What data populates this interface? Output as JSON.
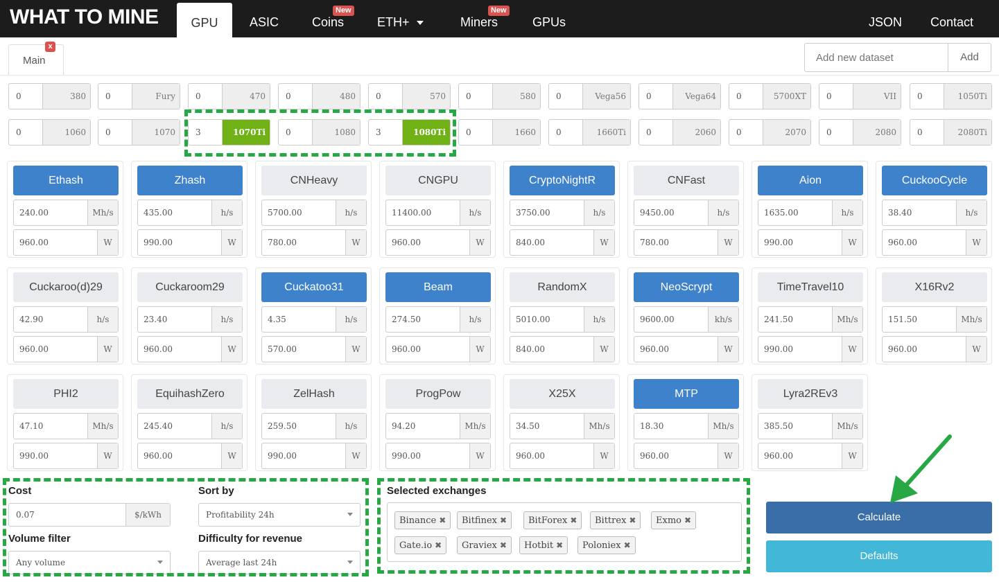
{
  "brand": "WHAT TO MINE",
  "nav": {
    "gpu": "GPU",
    "asic": "ASIC",
    "coins": "Coins",
    "coins_badge": "New",
    "eth": "ETH+",
    "miners": "Miners",
    "miners_badge": "New",
    "gpus": "GPUs",
    "json": "JSON",
    "contact": "Contact"
  },
  "datasets": {
    "tab": "Main",
    "close": "x",
    "input_placeholder": "Add new dataset",
    "add": "Add"
  },
  "gpus": [
    {
      "qty": "0",
      "name": "380"
    },
    {
      "qty": "0",
      "name": "Fury"
    },
    {
      "qty": "0",
      "name": "470"
    },
    {
      "qty": "0",
      "name": "480"
    },
    {
      "qty": "0",
      "name": "570"
    },
    {
      "qty": "0",
      "name": "580"
    },
    {
      "qty": "0",
      "name": "Vega56"
    },
    {
      "qty": "0",
      "name": "Vega64"
    },
    {
      "qty": "0",
      "name": "5700XT"
    },
    {
      "qty": "0",
      "name": "VII"
    },
    {
      "qty": "0",
      "name": "1050Ti"
    },
    {
      "qty": "0",
      "name": "1060"
    },
    {
      "qty": "0",
      "name": "1070"
    },
    {
      "qty": "3",
      "name": "1070Ti",
      "on": true
    },
    {
      "qty": "0",
      "name": "1080"
    },
    {
      "qty": "3",
      "name": "1080Ti",
      "on": true
    },
    {
      "qty": "0",
      "name": "1660"
    },
    {
      "qty": "0",
      "name": "1660Ti"
    },
    {
      "qty": "0",
      "name": "2060"
    },
    {
      "qty": "0",
      "name": "2070"
    },
    {
      "qty": "0",
      "name": "2080"
    },
    {
      "qty": "0",
      "name": "2080Ti"
    }
  ],
  "algos": [
    {
      "name": "Ethash",
      "on": true,
      "hashrate": "240.00",
      "unit": "Mh/s",
      "power": "960.00"
    },
    {
      "name": "Zhash",
      "on": true,
      "hashrate": "435.00",
      "unit": "h/s",
      "power": "990.00"
    },
    {
      "name": "CNHeavy",
      "on": false,
      "hashrate": "5700.00",
      "unit": "h/s",
      "power": "780.00"
    },
    {
      "name": "CNGPU",
      "on": false,
      "hashrate": "11400.00",
      "unit": "h/s",
      "power": "960.00"
    },
    {
      "name": "CryptoNightR",
      "on": true,
      "hashrate": "3750.00",
      "unit": "h/s",
      "power": "840.00"
    },
    {
      "name": "CNFast",
      "on": false,
      "hashrate": "9450.00",
      "unit": "h/s",
      "power": "780.00"
    },
    {
      "name": "Aion",
      "on": true,
      "hashrate": "1635.00",
      "unit": "h/s",
      "power": "990.00"
    },
    {
      "name": "CuckooCycle",
      "on": true,
      "hashrate": "38.40",
      "unit": "h/s",
      "power": "960.00"
    },
    {
      "name": "Cuckaroo(d)29",
      "on": false,
      "hashrate": "42.90",
      "unit": "h/s",
      "power": "960.00"
    },
    {
      "name": "Cuckaroom29",
      "on": false,
      "hashrate": "23.40",
      "unit": "h/s",
      "power": "960.00"
    },
    {
      "name": "Cuckatoo31",
      "on": true,
      "hashrate": "4.35",
      "unit": "h/s",
      "power": "570.00"
    },
    {
      "name": "Beam",
      "on": true,
      "hashrate": "274.50",
      "unit": "h/s",
      "power": "960.00"
    },
    {
      "name": "RandomX",
      "on": false,
      "hashrate": "5010.00",
      "unit": "h/s",
      "power": "840.00"
    },
    {
      "name": "NeoScrypt",
      "on": true,
      "hashrate": "9600.00",
      "unit": "kh/s",
      "power": "960.00"
    },
    {
      "name": "TimeTravel10",
      "on": false,
      "hashrate": "241.50",
      "unit": "Mh/s",
      "power": "990.00"
    },
    {
      "name": "X16Rv2",
      "on": false,
      "hashrate": "151.50",
      "unit": "Mh/s",
      "power": "960.00"
    },
    {
      "name": "PHI2",
      "on": false,
      "hashrate": "47.10",
      "unit": "Mh/s",
      "power": "990.00"
    },
    {
      "name": "EquihashZero",
      "on": false,
      "hashrate": "245.40",
      "unit": "h/s",
      "power": "960.00"
    },
    {
      "name": "ZelHash",
      "on": false,
      "hashrate": "259.50",
      "unit": "h/s",
      "power": "990.00"
    },
    {
      "name": "ProgPow",
      "on": false,
      "hashrate": "94.20",
      "unit": "Mh/s",
      "power": "990.00"
    },
    {
      "name": "X25X",
      "on": false,
      "hashrate": "34.50",
      "unit": "Mh/s",
      "power": "960.00"
    },
    {
      "name": "MTP",
      "on": true,
      "hashrate": "18.30",
      "unit": "Mh/s",
      "power": "960.00"
    },
    {
      "name": "Lyra2REv3",
      "on": false,
      "hashrate": "385.50",
      "unit": "Mh/s",
      "power": "960.00"
    }
  ],
  "power_unit": "W",
  "settings": {
    "cost_label": "Cost",
    "cost_value": "0.07",
    "cost_unit": "$/kWh",
    "volume_label": "Volume filter",
    "volume_value": "Any volume",
    "sort_label": "Sort by",
    "sort_value": "Profitability 24h",
    "difficulty_label": "Difficulty for revenue",
    "difficulty_value": "Average last 24h"
  },
  "exchanges": {
    "label": "Selected exchanges",
    "items": [
      "Binance",
      "Bitfinex",
      "BitForex",
      "Bittrex",
      "Exmo",
      "Gate.io",
      "Graviex",
      "Hotbit",
      "Poloniex"
    ],
    "remove_glyph": "✖"
  },
  "actions": {
    "calculate": "Calculate",
    "defaults": "Defaults"
  },
  "colors": {
    "accent": "#3f82cc",
    "selected_gpu": "#70b215",
    "highlight": "#27a844",
    "calculate": "#3a6ea8",
    "defaults": "#43b7d8"
  }
}
